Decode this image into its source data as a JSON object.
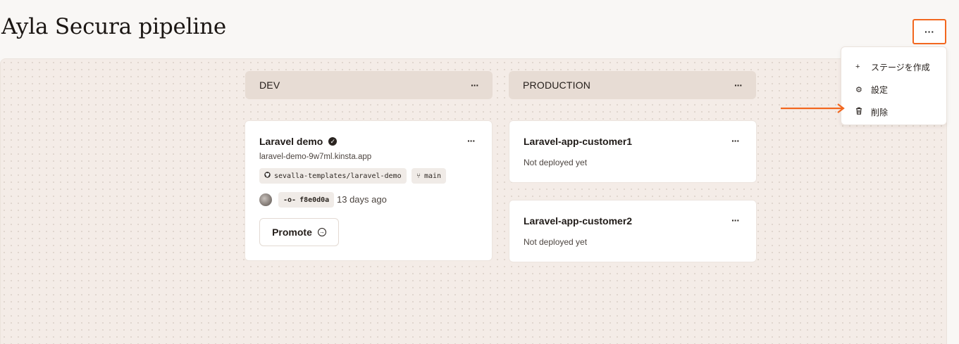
{
  "page": {
    "title": "Ayla Secura pipeline",
    "more_label": "···"
  },
  "stages": [
    {
      "label": "DEV",
      "menu_label": "···"
    },
    {
      "label": "PRODUCTION",
      "menu_label": "···"
    }
  ],
  "dev_card": {
    "name": "Laravel demo",
    "verified_icon": "✓",
    "url": "laravel-demo-9w7ml.kinsta.app",
    "repo": "sevalla-templates/laravel-demo",
    "repo_icon": "github-icon",
    "branch": "main",
    "branch_icon": "branch-icon",
    "commit": "f8e0d0a",
    "commit_icon": "commit-icon",
    "deployed_ago": "13 days ago",
    "promote_label": "Promote",
    "menu_label": "···"
  },
  "prod_cards": [
    {
      "name": "Laravel-app-customer1",
      "status": "Not deployed yet",
      "menu_label": "···"
    },
    {
      "name": "Laravel-app-customer2",
      "status": "Not deployed yet",
      "menu_label": "···"
    }
  ],
  "dropdown": {
    "items": [
      {
        "icon": "plus-icon",
        "glyph": "+",
        "label": "ステージを作成"
      },
      {
        "icon": "gear-icon",
        "glyph": "⚙",
        "label": "設定"
      },
      {
        "icon": "trash-icon",
        "glyph": "🗑",
        "label": "削除"
      }
    ]
  },
  "colors": {
    "accent": "#f2671f",
    "stage_header": "#e7dcd4",
    "canvas": "#f4ece7"
  }
}
